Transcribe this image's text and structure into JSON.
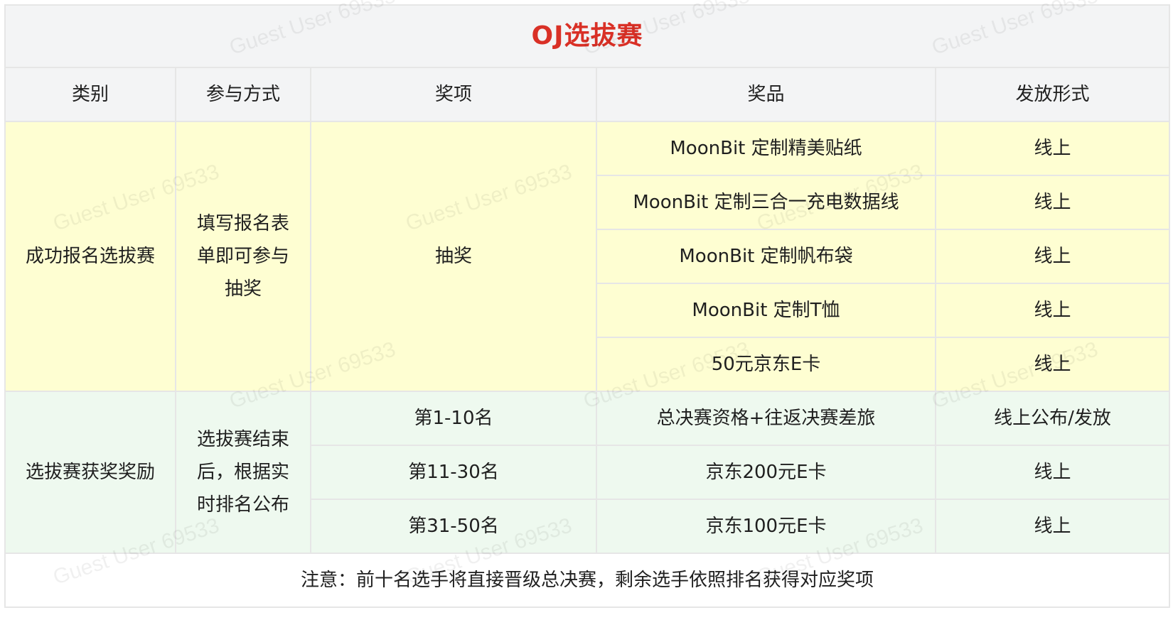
{
  "title": "OJ选拔赛",
  "colors": {
    "title": "#d93026",
    "header_bg": "#f3f4f5",
    "section1_bg": "#fefed2",
    "section2_bg": "#eef9ef",
    "border": "#e6e6e6"
  },
  "headers": [
    "类别",
    "参与方式",
    "奖项",
    "奖品",
    "发放形式"
  ],
  "section1": {
    "category": "成功报名选拔赛",
    "method": "填写报名表单即可参与抽奖",
    "award": "抽奖",
    "rows": [
      {
        "prize": "MoonBit 定制精美贴纸",
        "delivery": "线上"
      },
      {
        "prize": "MoonBit 定制三合一充电数据线",
        "delivery": "线上"
      },
      {
        "prize": "MoonBit 定制帆布袋",
        "delivery": "线上"
      },
      {
        "prize": "MoonBit 定制T恤",
        "delivery": "线上"
      },
      {
        "prize": "50元京东E卡",
        "delivery": "线上"
      }
    ]
  },
  "section2": {
    "category": "选拔赛获奖奖励",
    "method": "选拔赛结束后，根据实时排名公布",
    "rows": [
      {
        "award": "第1-10名",
        "prize": "总决赛资格+往返决赛差旅",
        "delivery": "线上公布/发放"
      },
      {
        "award": "第11-30名",
        "prize": "京东200元E卡",
        "delivery": "线上"
      },
      {
        "award": "第31-50名",
        "prize": "京东100元E卡",
        "delivery": "线上"
      }
    ]
  },
  "note": "注意：前十名选手将直接晋级总决赛，剩余选手依照排名获得对应奖项",
  "watermark": "Guest User 69533"
}
